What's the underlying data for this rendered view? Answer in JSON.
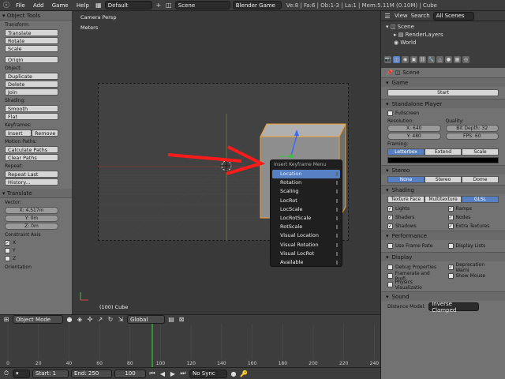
{
  "topbar": {
    "menus": [
      "File",
      "Add",
      "Game",
      "Help"
    ],
    "screen": "Default",
    "scene": "Scene",
    "engine": "Blender Game",
    "info": "Ve:8 | Fa:6 | Ob:1-3 | La:1 | Mem:5.11M (0.10M) | Cube"
  },
  "toolshelf": {
    "title": "Object Tools",
    "transform_label": "Transform:",
    "transform_buttons": [
      "Translate",
      "Rotate",
      "Scale"
    ],
    "origin_button": "Origin",
    "object_label": "Object:",
    "object_buttons": [
      "Duplicate",
      "Delete",
      "Join"
    ],
    "shading_label": "Shading:",
    "shading_buttons": [
      "Smooth",
      "Flat"
    ],
    "keyframes_label": "Keyframes:",
    "insert_button": "Insert",
    "remove_button": "Remove",
    "motion_label": "Motion Paths:",
    "motion_buttons": [
      "Calculate Paths",
      "Clear Paths"
    ],
    "repeat_label": "Repeat:",
    "repeat_buttons": [
      "Repeat Last",
      "History..."
    ],
    "operator_title": "Translate",
    "vector_label": "Vector:",
    "vector_values": [
      "X: 4.517m",
      "Y: 0m",
      "Z: 0m"
    ],
    "constraint_label": "Constraint Axis",
    "axes": [
      "X",
      "Y",
      "Z"
    ],
    "orientation_label": "Orientation"
  },
  "viewport": {
    "view_name": "Camera Persp",
    "units": "Meters",
    "object_label": "(100) Cube",
    "popup": {
      "title": "Insert Keyframe Menu",
      "items": [
        "Location",
        "Rotation",
        "Scaling",
        "LocRot",
        "LocScale",
        "LocRotScale",
        "RotScale",
        "Visual Location",
        "Visual Rotation",
        "Visual LocRot",
        "Available"
      ],
      "highlighted": 0
    }
  },
  "viewport_header": {
    "mode": "Object Mode",
    "orientation": "Global"
  },
  "timeline": {
    "ticks": [
      "0",
      "20",
      "40",
      "60",
      "80",
      "100",
      "120",
      "140",
      "160",
      "180",
      "200",
      "220",
      "240"
    ],
    "start": "Start: 1",
    "end": "End: 250",
    "current": "100",
    "sync": "No Sync"
  },
  "outliner": {
    "view": "View",
    "search": "Search",
    "filter": "All Scenes",
    "tree": [
      "Scene",
      "RenderLayers",
      "World"
    ]
  },
  "properties": {
    "context": "Scene",
    "game": {
      "title": "Game",
      "start_button": "Start"
    },
    "player": {
      "title": "Standalone Player",
      "fullscreen": "Fullscreen",
      "resolution_label": "Resolution:",
      "quality_label": "Quality:",
      "res_x": "X: 640",
      "res_y": "Y: 480",
      "bitdepth": "Bit Depth: 32",
      "fps": "FPS: 60",
      "framing_label": "Framing:",
      "framing_options": [
        "Letterbox",
        "Extend",
        "Scale"
      ]
    },
    "stereo": {
      "title": "Stereo",
      "options": [
        "None",
        "Stereo",
        "Dome"
      ]
    },
    "shading": {
      "title": "Shading",
      "modes": [
        "Texture Face",
        "Multitexture",
        "GLSL"
      ],
      "checks": [
        "Lights",
        "Ramps",
        "Shaders",
        "Nodes",
        "Shadows",
        "Extra Textures"
      ]
    },
    "performance": {
      "title": "Performance",
      "checks": [
        "Use Frame Rate",
        "Display Lists"
      ]
    },
    "display": {
      "title": "Display",
      "checks": [
        "Debug Properties",
        "Deprecation Warni",
        "Framerate and Profi",
        "Show Mouse",
        "Physics Visualizatio"
      ]
    },
    "sound": {
      "title": "Sound",
      "distance_label": "Distance Model:",
      "distance_value": "Inverse Clamped"
    }
  },
  "colors": {
    "accent": "#5680c2",
    "arrow": "#ff1a1a",
    "selection": "#f0a030"
  }
}
